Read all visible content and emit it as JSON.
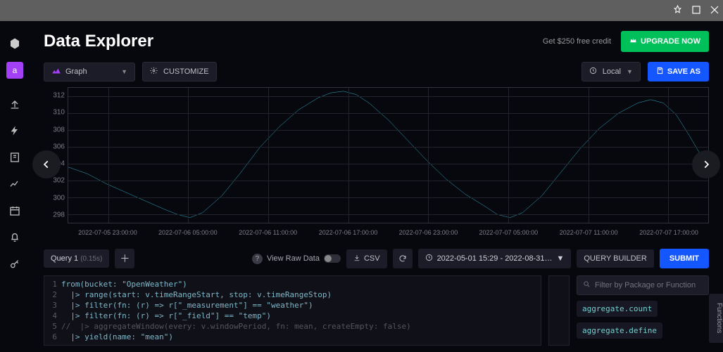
{
  "window": {
    "pin_icon": "pin",
    "restore_icon": "restore",
    "close_icon": "close"
  },
  "sidebar": {
    "logo": "influx",
    "avatar": "a",
    "icons": [
      "upload",
      "bolt",
      "note",
      "chart",
      "calendar",
      "bell",
      "key"
    ]
  },
  "header": {
    "title": "Data Explorer",
    "credit_text": "Get $250 free credit",
    "upgrade_label": "UPGRADE NOW"
  },
  "toolbar": {
    "viz_label": "Graph",
    "customize_label": "CUSTOMIZE",
    "timezone_label": "Local",
    "save_label": "SAVE AS"
  },
  "chart_data": {
    "type": "line",
    "ylabel": "",
    "ylim": [
      297,
      313
    ],
    "y_ticks": [
      298,
      300,
      302,
      304,
      306,
      308,
      310,
      312
    ],
    "x_ticks": [
      "2022-07-05 23:00:00",
      "2022-07-06 05:00:00",
      "2022-07-06 11:00:00",
      "2022-07-06 17:00:00",
      "2022-07-06 23:00:00",
      "2022-07-07 05:00:00",
      "2022-07-07 11:00:00",
      "2022-07-07 17:00:00"
    ],
    "series": [
      {
        "name": "temp",
        "color": "#2fb2c6",
        "values": [
          {
            "t": 0.0,
            "v": 303.6
          },
          {
            "t": 0.03,
            "v": 302.8
          },
          {
            "t": 0.06,
            "v": 301.6
          },
          {
            "t": 0.09,
            "v": 300.6
          },
          {
            "t": 0.12,
            "v": 299.6
          },
          {
            "t": 0.15,
            "v": 298.6
          },
          {
            "t": 0.17,
            "v": 298.0
          },
          {
            "t": 0.19,
            "v": 297.6
          },
          {
            "t": 0.21,
            "v": 298.2
          },
          {
            "t": 0.24,
            "v": 300.2
          },
          {
            "t": 0.27,
            "v": 303.0
          },
          {
            "t": 0.3,
            "v": 306.0
          },
          {
            "t": 0.33,
            "v": 308.4
          },
          {
            "t": 0.36,
            "v": 310.4
          },
          {
            "t": 0.39,
            "v": 311.8
          },
          {
            "t": 0.41,
            "v": 312.4
          },
          {
            "t": 0.43,
            "v": 312.6
          },
          {
            "t": 0.45,
            "v": 312.2
          },
          {
            "t": 0.47,
            "v": 311.2
          },
          {
            "t": 0.5,
            "v": 309.2
          },
          {
            "t": 0.53,
            "v": 306.8
          },
          {
            "t": 0.56,
            "v": 304.4
          },
          {
            "t": 0.59,
            "v": 302.2
          },
          {
            "t": 0.62,
            "v": 300.4
          },
          {
            "t": 0.65,
            "v": 299.0
          },
          {
            "t": 0.67,
            "v": 298.0
          },
          {
            "t": 0.69,
            "v": 297.6
          },
          {
            "t": 0.71,
            "v": 298.2
          },
          {
            "t": 0.74,
            "v": 300.2
          },
          {
            "t": 0.77,
            "v": 303.0
          },
          {
            "t": 0.8,
            "v": 305.8
          },
          {
            "t": 0.83,
            "v": 308.2
          },
          {
            "t": 0.86,
            "v": 310.0
          },
          {
            "t": 0.89,
            "v": 311.2
          },
          {
            "t": 0.91,
            "v": 311.6
          },
          {
            "t": 0.93,
            "v": 311.2
          },
          {
            "t": 0.95,
            "v": 309.8
          },
          {
            "t": 0.97,
            "v": 307.4
          },
          {
            "t": 0.99,
            "v": 304.8
          },
          {
            "t": 1.0,
            "v": 303.2
          }
        ]
      }
    ]
  },
  "query_bar": {
    "tab_label": "Query 1",
    "tab_time": "(0.15s)",
    "raw_label": "View Raw Data",
    "csv_label": "CSV",
    "range_label": "2022-05-01 15:29 - 2022-08-31…",
    "builder_label": "QUERY BUILDER",
    "submit_label": "SUBMIT"
  },
  "editor": {
    "lines": [
      "from(bucket: \"OpenWeather\")",
      "  |> range(start: v.timeRangeStart, stop: v.timeRangeStop)",
      "  |> filter(fn: (r) => r[\"_measurement\"] == \"weather\")",
      "  |> filter(fn: (r) => r[\"_field\"] == \"temp\")",
      "//  |> aggregateWindow(every: v.windowPeriod, fn: mean, createEmpty: false)",
      "  |> yield(name: \"mean\")"
    ]
  },
  "functions": {
    "placeholder": "Filter by Package or Function",
    "items": [
      "aggregate.count",
      "aggregate.define"
    ],
    "side_label": "Functions"
  }
}
